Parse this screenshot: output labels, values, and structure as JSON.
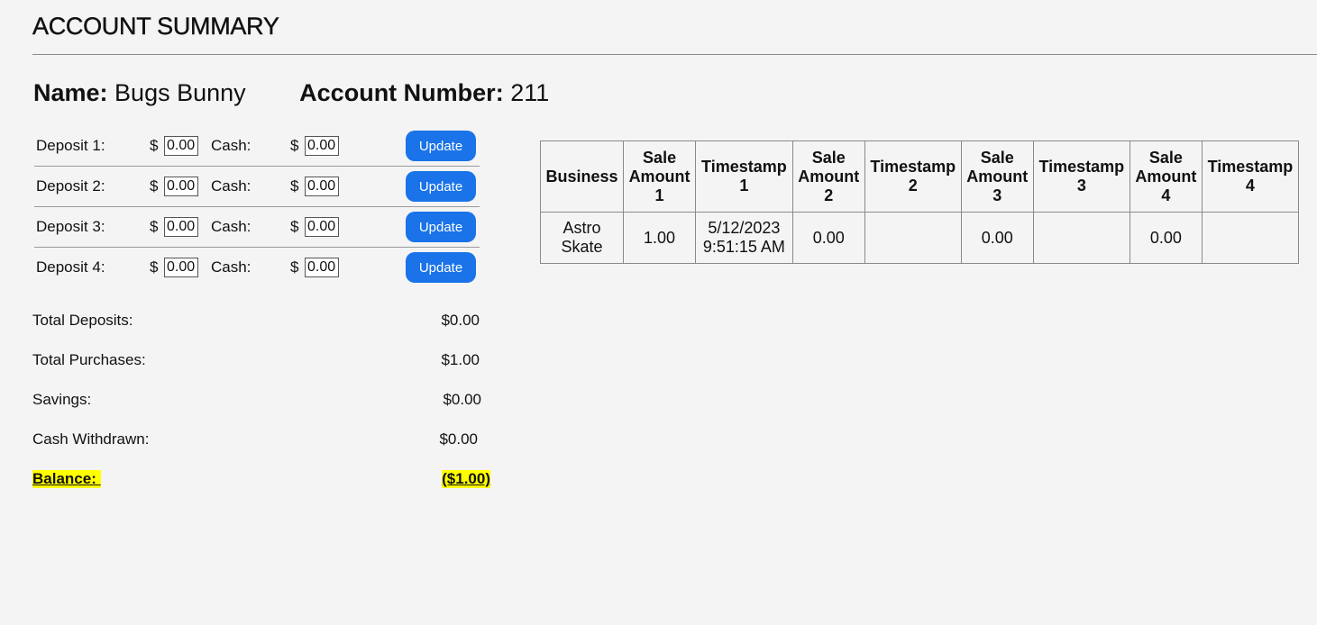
{
  "page": {
    "title": "ACCOUNT SUMMARY"
  },
  "account": {
    "name_label": "Name:",
    "name": "Bugs Bunny",
    "number_label": "Account Number:",
    "number": "211"
  },
  "deposits": [
    {
      "label": "Deposit 1:",
      "currency": "$",
      "deposit_value": "0.00",
      "cash_label": "Cash:",
      "cash_value": "0.00",
      "button": "Update"
    },
    {
      "label": "Deposit 2:",
      "currency": "$",
      "deposit_value": "0.00",
      "cash_label": "Cash:",
      "cash_value": "0.00",
      "button": "Update"
    },
    {
      "label": "Deposit 3:",
      "currency": "$",
      "deposit_value": "0.00",
      "cash_label": "Cash:",
      "cash_value": "0.00",
      "button": "Update"
    },
    {
      "label": "Deposit 4:",
      "currency": "$",
      "deposit_value": "0.00",
      "cash_label": "Cash:",
      "cash_value": "0.00",
      "button": "Update"
    }
  ],
  "totals": [
    {
      "label": "Total Deposits:",
      "value": "$0.00"
    },
    {
      "label": "Total Purchases:",
      "value": "$1.00"
    },
    {
      "label": "Savings:",
      "value": "$0.00"
    },
    {
      "label": "Cash Withdrawn:",
      "value": "$0.00"
    }
  ],
  "balance": {
    "label": "Balance: ",
    "value": "($1.00)"
  },
  "sales_table": {
    "headers": [
      [
        "Business"
      ],
      [
        "Sale",
        "Amount",
        "1"
      ],
      [
        "Timestamp",
        "1"
      ],
      [
        "Sale",
        "Amount",
        "2"
      ],
      [
        "Timestamp",
        "2"
      ],
      [
        "Sale",
        "Amount",
        "3"
      ],
      [
        "Timestamp",
        "3"
      ],
      [
        "Sale",
        "Amount",
        "4"
      ],
      [
        "Timestamp",
        "4"
      ]
    ],
    "rows": [
      [
        [
          "Astro",
          "Skate"
        ],
        [
          "1.00"
        ],
        [
          "5/12/2023",
          "9:51:15 AM"
        ],
        [
          "0.00"
        ],
        [
          ""
        ],
        [
          "0.00"
        ],
        [
          ""
        ],
        [
          "0.00"
        ],
        [
          ""
        ]
      ]
    ]
  },
  "colors": {
    "button_bg": "#1a73e8",
    "highlight": "#ffff00",
    "page_bg": "#f4f4f4"
  }
}
